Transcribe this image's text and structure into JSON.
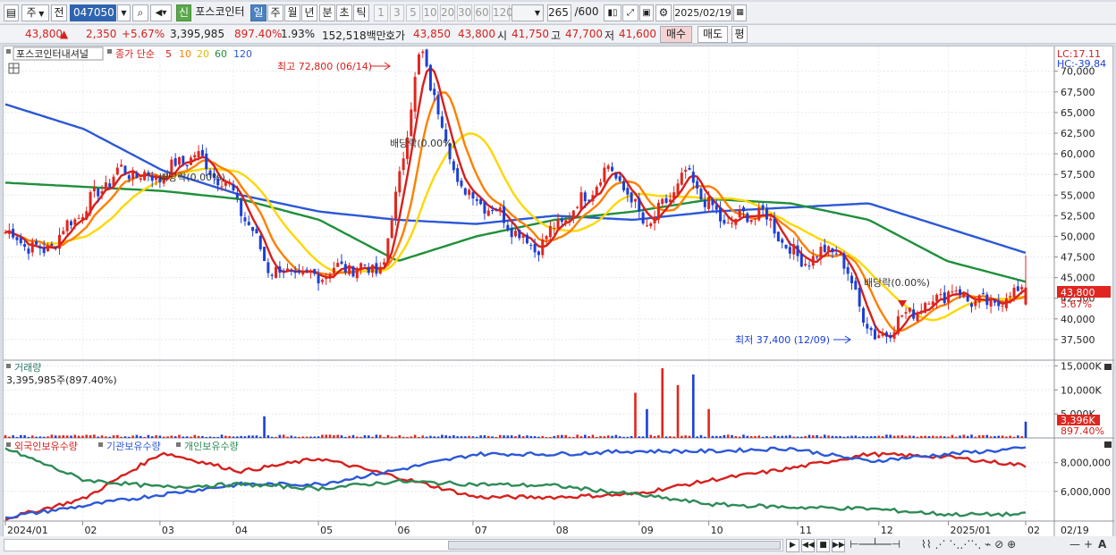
{
  "toolbar": {
    "market": "주",
    "prev_label": "전",
    "code": "047050",
    "sin_label": "신",
    "stock_name": "포스코인터",
    "periods": [
      "일",
      "주",
      "월",
      "년",
      "분",
      "초",
      "틱"
    ],
    "active_period": "일",
    "intervals": [
      "1",
      "3",
      "5",
      "10",
      "20",
      "30",
      "60",
      "120"
    ],
    "count": "265",
    "count_max": "/600",
    "date": "2025/02/19"
  },
  "quote": {
    "price": "43,800",
    "change_arrow": "▲",
    "change": "2,350",
    "change_pct": "+5.67%",
    "volume": "3,395,985",
    "volume_pct": "897.40%",
    "turnover_rate": "1.93%",
    "amount": "152,518백만",
    "ask_label": "호가",
    "ask": "43,850",
    "bid": "43,800",
    "open_label": "시",
    "open": "41,750",
    "high_label": "고",
    "high": "47,700",
    "low_label": "저",
    "low": "41,600",
    "buy_label": "매수",
    "sell_label": "매도",
    "eval_label": "평"
  },
  "legend": {
    "name": "포스코인터내셔널",
    "title": "종가 단순",
    "periods": [
      "5",
      "10",
      "20",
      "60",
      "120"
    ],
    "colors": [
      "#d6201c",
      "#ff7f00",
      "#ffd700",
      "#1f8f3a",
      "#2c58d6"
    ]
  },
  "scale": {
    "lc": "LC:17.11",
    "hc": "HC:-39.84",
    "price_badge": "43,800",
    "price_pct": "5.67%",
    "vol_badge": "3,396K",
    "vol_pct": "897.40%"
  },
  "annotations": {
    "high": "최고 72,800 (06/14)",
    "low": "최저 37,400 (12/09)",
    "ex_div_1": "배당락(0.00%)",
    "ex_div_2": "배당락(0.00%)",
    "ex_div_3": "배당락(0.00%)"
  },
  "volume_panel": {
    "title": "거래량",
    "value": "3,395,985주(897.40%)"
  },
  "holdings_panel": {
    "series": [
      "외국인보유수량",
      "기관보유수량",
      "개인보유수량"
    ],
    "colors": [
      "#d6201c",
      "#2c58d6",
      "#2e8b57"
    ]
  },
  "chart_data": [
    {
      "type": "candlestick",
      "title": "포스코인터내셔널 종가 단순",
      "y_ticks": [
        37500,
        40000,
        42500,
        45000,
        47500,
        50000,
        52500,
        55000,
        57500,
        60000,
        62500,
        65000,
        67500,
        70000
      ],
      "ylim": [
        35000,
        73000
      ],
      "x_labels": [
        "2024/01",
        "02",
        "03",
        "04",
        "05",
        "06",
        "07",
        "08",
        "09",
        "10",
        "11",
        "12",
        "2025/01",
        "02",
        "02/19"
      ],
      "close_anchors": [
        {
          "m": "2024/01",
          "v": 50500
        },
        {
          "m": "01m",
          "v": 48000
        },
        {
          "m": "02",
          "v": 53000
        },
        {
          "m": "02m",
          "v": 58000
        },
        {
          "m": "03",
          "v": 57000
        },
        {
          "m": "03m",
          "v": 60000
        },
        {
          "m": "04",
          "v": 55500
        },
        {
          "m": "04m",
          "v": 46000
        },
        {
          "m": "05",
          "v": 45000
        },
        {
          "m": "05m",
          "v": 46300
        },
        {
          "m": "06",
          "v": 46000
        },
        {
          "m": "06m",
          "v": 72800
        },
        {
          "m": "07",
          "v": 56000
        },
        {
          "m": "07m",
          "v": 53000
        },
        {
          "m": "08",
          "v": 48500
        },
        {
          "m": "08m",
          "v": 53000
        },
        {
          "m": "09",
          "v": 58500
        },
        {
          "m": "09m",
          "v": 51000
        },
        {
          "m": "10",
          "v": 57500
        },
        {
          "m": "10m",
          "v": 51500
        },
        {
          "m": "11",
          "v": 53000
        },
        {
          "m": "11m",
          "v": 47000
        },
        {
          "m": "12",
          "v": 48500
        },
        {
          "m": "12m",
          "v": 37400
        },
        {
          "m": "2025/01",
          "v": 41000
        },
        {
          "m": "01m",
          "v": 43500
        },
        {
          "m": "02",
          "v": 41500
        },
        {
          "m": "02/19",
          "v": 43800
        }
      ],
      "ma_periods": [
        5,
        10,
        20,
        60,
        120
      ],
      "ma120_anchors": [
        66000,
        63000,
        58000,
        55000,
        53000,
        52000,
        51500,
        52500,
        52000,
        53000,
        53500,
        54000,
        51000,
        48000
      ],
      "ma60_anchors": [
        56500,
        56000,
        55500,
        54500,
        52000,
        47000,
        50000,
        52000,
        53000,
        54500,
        54000,
        52000,
        47000,
        44500
      ],
      "last": {
        "open": 41750,
        "high": 47700,
        "low": 41600,
        "close": 43800
      }
    },
    {
      "type": "bar",
      "title": "거래량",
      "y_ticks": [
        5000000,
        10000000,
        15000000
      ],
      "y_tick_labels": [
        "5,000K",
        "10,000K",
        "15,000K"
      ],
      "ylim": [
        0,
        16000000
      ],
      "baseline_volume": 380000,
      "spikes": [
        {
          "date": "03",
          "value": 4500000
        },
        {
          "date": "06",
          "value": 9400000
        },
        {
          "date": "06",
          "value": 6000000
        },
        {
          "date": "06",
          "value": 14500000
        },
        {
          "date": "06",
          "value": 11000000
        },
        {
          "date": "06",
          "value": 13200000
        },
        {
          "date": "06",
          "value": 6000000
        },
        {
          "date": "02/19",
          "value": 3395985
        }
      ]
    },
    {
      "type": "line",
      "title": "보유수량",
      "y_ticks": [
        6000000,
        8000000
      ],
      "y_tick_labels": [
        "6,000,000",
        "8,000,000"
      ],
      "ylim": [
        4000000,
        9600000
      ],
      "series": [
        {
          "name": "외국인보유수량",
          "values": [
            4100000,
            5500000,
            8700000,
            7400000,
            8300000,
            7000000,
            5600000,
            5600000,
            5800000,
            6800000,
            7600000,
            8600000,
            8400000,
            7800000
          ]
        },
        {
          "name": "기관보유수량",
          "values": [
            4200000,
            5000000,
            5800000,
            6500000,
            6500000,
            7500000,
            8600000,
            8600000,
            8800000,
            8800000,
            9000000,
            8100000,
            8600000,
            9000000
          ]
        },
        {
          "name": "개인보유수량",
          "values": [
            9000000,
            6800000,
            6300000,
            6500000,
            6200000,
            6700000,
            6500000,
            6400000,
            5800000,
            5100000,
            4900000,
            4800000,
            4400000,
            4400000
          ]
        }
      ]
    }
  ]
}
